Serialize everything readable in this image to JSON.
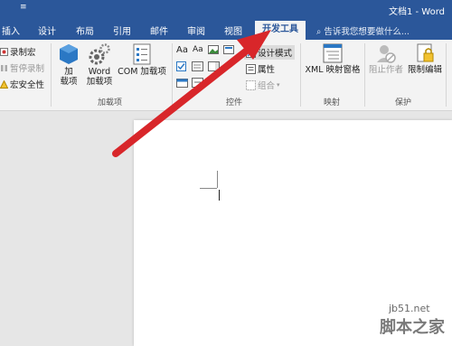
{
  "window": {
    "qat_label": "≡",
    "document_title": "文档1 - Word"
  },
  "tabs": [
    "插入",
    "设计",
    "布局",
    "引用",
    "邮件",
    "审阅",
    "视图",
    "开发工具"
  ],
  "active_tab": "开发工具",
  "tell_me": "告诉我您想要做什么...",
  "ribbon": {
    "code": {
      "record_macro": "录制宏",
      "pause_recording": "暂停录制",
      "macro_security": "宏安全性"
    },
    "addins": {
      "addins_top": "加",
      "addins_bottom": "载项",
      "word_addins_top": "Word",
      "word_addins_bottom": "加载项",
      "com_addins": "COM 加载项",
      "group_label": "加载项"
    },
    "controls": {
      "aa1": "Aa",
      "aa2": "Aa",
      "design_mode": "设计模式",
      "properties": "属性",
      "group": "组合",
      "group_label": "控件"
    },
    "mapping": {
      "xml_pane": "XML 映射窗格",
      "group_label": "映射"
    },
    "protect": {
      "block_authors": "阻止作者",
      "restrict_editing": "限制编辑",
      "group_label": "保护"
    }
  },
  "watermark": {
    "site": "jb51.net",
    "name": "脚本之家"
  },
  "colors": {
    "word_blue": "#2b579a",
    "arrow_red": "#d8262a"
  }
}
